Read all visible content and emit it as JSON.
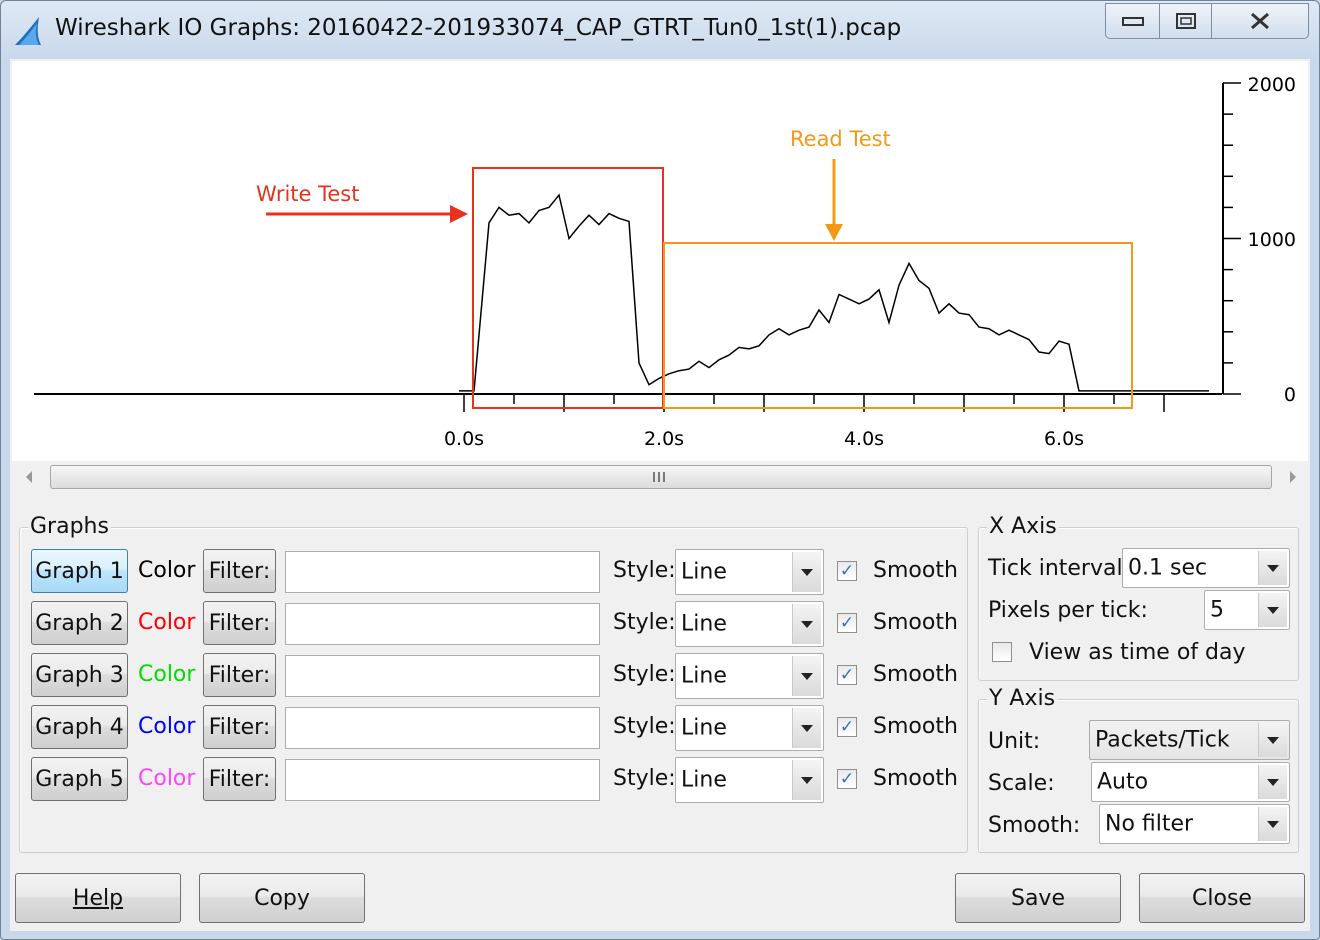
{
  "window": {
    "title": "Wireshark IO Graphs: 20160422-201933074_CAP_GTRT_Tun0_1st(1).pcap",
    "minimize_icon": "minimize-icon",
    "maximize_icon": "maximize-icon",
    "close_icon": "close-icon"
  },
  "chart_data": {
    "type": "line",
    "x_tick_labels": [
      "0.0s",
      "2.0s",
      "4.0s",
      "6.0s"
    ],
    "y_tick_labels": [
      "2000",
      "1000",
      "0"
    ],
    "ylim": [
      0,
      2000
    ],
    "annotations": [
      {
        "text": "Write Test",
        "color": "#e8321e"
      },
      {
        "text": "Read Test",
        "color": "#f29a16"
      }
    ],
    "series": [
      {
        "color": "#000000",
        "x": [
          -0.05,
          0.1,
          0.25,
          0.35,
          0.45,
          0.55,
          0.65,
          0.75,
          0.85,
          0.95,
          1.05,
          1.15,
          1.25,
          1.35,
          1.45,
          1.55,
          1.65,
          1.75,
          1.85,
          1.95,
          2.05,
          2.15,
          2.25,
          2.35,
          2.45,
          2.55,
          2.65,
          2.75,
          2.85,
          2.95,
          3.05,
          3.15,
          3.25,
          3.35,
          3.45,
          3.55,
          3.65,
          3.75,
          3.85,
          3.95,
          4.05,
          4.15,
          4.25,
          4.35,
          4.45,
          4.55,
          4.65,
          4.75,
          4.85,
          4.95,
          5.05,
          5.15,
          5.25,
          5.35,
          5.45,
          5.55,
          5.65,
          5.75,
          5.85,
          5.95,
          6.05,
          6.15,
          6.25,
          6.35,
          6.45,
          6.55,
          6.65,
          6.75,
          7.0,
          7.45
        ],
        "values": [
          20,
          20,
          1100,
          1200,
          1150,
          1160,
          1100,
          1180,
          1200,
          1280,
          1000,
          1080,
          1150,
          1090,
          1160,
          1130,
          1110,
          200,
          60,
          100,
          130,
          150,
          160,
          210,
          170,
          220,
          250,
          300,
          290,
          310,
          380,
          420,
          380,
          410,
          430,
          540,
          460,
          640,
          610,
          580,
          610,
          670,
          460,
          700,
          840,
          730,
          680,
          520,
          580,
          520,
          510,
          430,
          420,
          380,
          410,
          380,
          350,
          270,
          260,
          340,
          320,
          20,
          20,
          20,
          20,
          20,
          20,
          20,
          20,
          20
        ]
      }
    ]
  },
  "graphs": {
    "legend": "Graphs",
    "rows": [
      {
        "button": "Graph 1",
        "color_label": "Color",
        "color": "#000000",
        "filter_label": "Filter:",
        "filter_value": "",
        "style_label": "Style:",
        "style_value": "Line",
        "smooth_label": "Smooth"
      },
      {
        "button": "Graph 2",
        "color_label": "Color",
        "color": "#ff0000",
        "filter_label": "Filter:",
        "filter_value": "",
        "style_label": "Style:",
        "style_value": "Line",
        "smooth_label": "Smooth"
      },
      {
        "button": "Graph 3",
        "color_label": "Color",
        "color": "#00dd00",
        "filter_label": "Filter:",
        "filter_value": "",
        "style_label": "Style:",
        "style_value": "Line",
        "smooth_label": "Smooth"
      },
      {
        "button": "Graph 4",
        "color_label": "Color",
        "color": "#0000ff",
        "filter_label": "Filter:",
        "filter_value": "",
        "style_label": "Style:",
        "style_value": "Line",
        "smooth_label": "Smooth"
      },
      {
        "button": "Graph 5",
        "color_label": "Color",
        "color": "#ff44ff",
        "filter_label": "Filter:",
        "filter_value": "",
        "style_label": "Style:",
        "style_value": "Line",
        "smooth_label": "Smooth"
      }
    ]
  },
  "x_axis": {
    "legend": "X Axis",
    "tick_interval_label": "Tick interval:",
    "tick_interval_value": "0.1 sec",
    "pixels_per_tick_label": "Pixels per tick:",
    "pixels_per_tick_value": "5",
    "time_of_day_label": "View as time of day"
  },
  "y_axis": {
    "legend": "Y Axis",
    "unit_label": "Unit:",
    "unit_value": "Packets/Tick",
    "scale_label": "Scale:",
    "scale_value": "Auto",
    "smooth_label": "Smooth:",
    "smooth_value": "No filter"
  },
  "footer": {
    "help": "Help",
    "copy": "Copy",
    "save": "Save",
    "close": "Close"
  }
}
